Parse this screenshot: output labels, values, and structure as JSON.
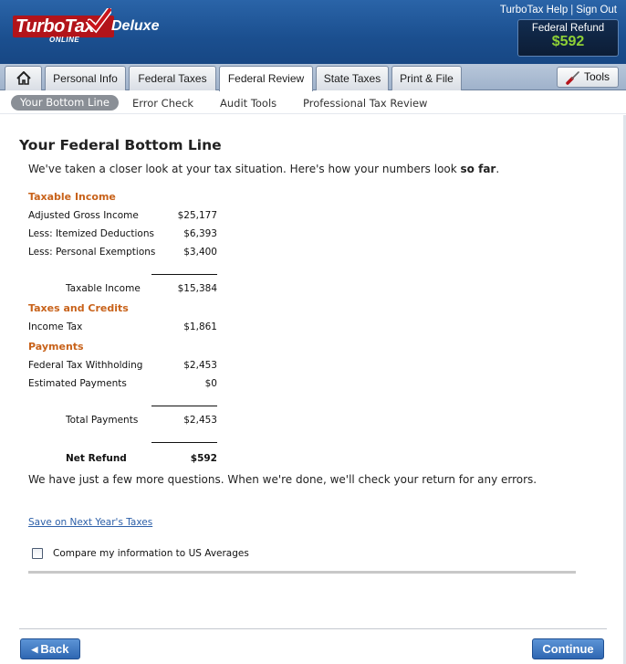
{
  "header": {
    "logo_text": "TurboTax",
    "logo_sub": "ONLINE",
    "edition": "Deluxe",
    "help_link": "TurboTax Help",
    "signout_link": "Sign Out",
    "refund_label": "Federal Refund",
    "refund_amount": "$592"
  },
  "tabs": [
    {
      "label": "Personal Info"
    },
    {
      "label": "Federal Taxes"
    },
    {
      "label": "Federal Review"
    },
    {
      "label": "State Taxes"
    },
    {
      "label": "Print & File"
    }
  ],
  "tools_label": "Tools",
  "subnav": [
    {
      "label": "Your Bottom Line"
    },
    {
      "label": "Error Check"
    },
    {
      "label": "Audit Tools"
    },
    {
      "label": "Professional Tax Review"
    }
  ],
  "main": {
    "title": "Your Federal Bottom Line",
    "intro_pre": "We've taken a closer look at your tax situation. Here's how your numbers look ",
    "intro_bold": "so far",
    "intro_post": ".",
    "taxable_income": {
      "heading": "Taxable Income",
      "rows": [
        {
          "label": "Adjusted Gross Income",
          "value": "$25,177"
        },
        {
          "label": "Less: Itemized Deductions",
          "value": "$6,393"
        },
        {
          "label": "Less: Personal Exemptions",
          "value": "$3,400"
        }
      ],
      "total": {
        "label": "Taxable Income",
        "value": "$15,384"
      }
    },
    "taxes_credits": {
      "heading": "Taxes and Credits",
      "rows": [
        {
          "label": "Income Tax",
          "value": "$1,861"
        }
      ]
    },
    "payments": {
      "heading": "Payments",
      "rows": [
        {
          "label": "Federal Tax Withholding",
          "value": "$2,453"
        },
        {
          "label": "Estimated Payments",
          "value": "$0"
        }
      ],
      "total": {
        "label": "Total Payments",
        "value": "$2,453"
      }
    },
    "net_refund": {
      "label": "Net Refund",
      "value": "$592"
    },
    "outro": "We have just a few more questions. When we're done, we'll check your return for any errors.",
    "save_link": "Save on Next Year's Taxes",
    "compare_label": "Compare my information to US Averages"
  },
  "footer": {
    "back_label": "Back",
    "continue_label": "Continue"
  },
  "colors": {
    "header_blue": "#1b4f8f",
    "section_orange": "#c8621a",
    "refund_green": "#8ed036",
    "button_blue": "#2f67b2"
  }
}
